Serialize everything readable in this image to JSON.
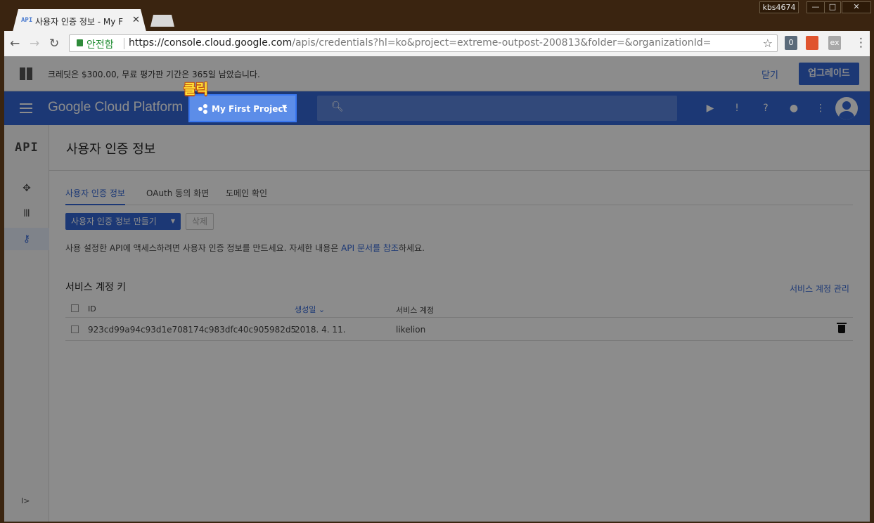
{
  "browser": {
    "tab_icon": "API",
    "tab_title": "사용자 인증 정보 - My F",
    "tab_close": "✕",
    "user_badge": "kbs4674",
    "win_buttons": [
      "—",
      "□",
      "✕"
    ],
    "security_label": "안전함",
    "url_host": "https://console.cloud.google.com",
    "url_path": "/apis/credentials?hl=ko&project=extreme-outpost-200813&folder=&organizationId=",
    "icons": [
      "back-icon",
      "forward-icon",
      "reload-icon",
      "lock-icon",
      "star-icon",
      "menu-dots-icon"
    ],
    "ext_labels": [
      "0",
      "",
      "ex"
    ]
  },
  "credit_bar": {
    "text": "크레딧은 $300.00, 무료 평가판 기간은 365일 남았습니다.",
    "close": "닫기",
    "upgrade": "업그레이드"
  },
  "topbar": {
    "logo": "Google Cloud Platform",
    "project": "My First Project",
    "callout": "클릭",
    "icons": [
      "hamburger-icon",
      "search-icon",
      "cloud-shell-icon",
      "feedback-icon",
      "help-icon",
      "notifications-icon",
      "more-vert-icon",
      "avatar-icon"
    ],
    "accent": "#3367d6"
  },
  "sidenav": {
    "logo": "API",
    "items": [
      "dashboard-icon",
      "library-icon",
      "credentials-icon"
    ],
    "collapse": "I>"
  },
  "main": {
    "title": "사용자 인증 정보",
    "tabs": [
      "사용자 인증 정보",
      "OAuth 동의 화면",
      "도메인 확인"
    ],
    "create_button": "사용자 인증 정보 만들기",
    "delete_button": "삭제",
    "info_prefix": "사용 설정한 API에 액세스하려면 사용자 인증 정보를 만드세요. 자세한 내용은 ",
    "info_link": "API 문서를 참조",
    "info_suffix": "하세요.",
    "section_title": "서비스 계정 키",
    "manage_link": "서비스 계정 관리",
    "columns": [
      "ID",
      "생성일",
      "서비스 계정"
    ],
    "rows": [
      {
        "id": "923cd99a94c93d1e708174c983dfc40c905982d5",
        "created": "2018. 4. 11.",
        "account": "likelion"
      }
    ]
  }
}
